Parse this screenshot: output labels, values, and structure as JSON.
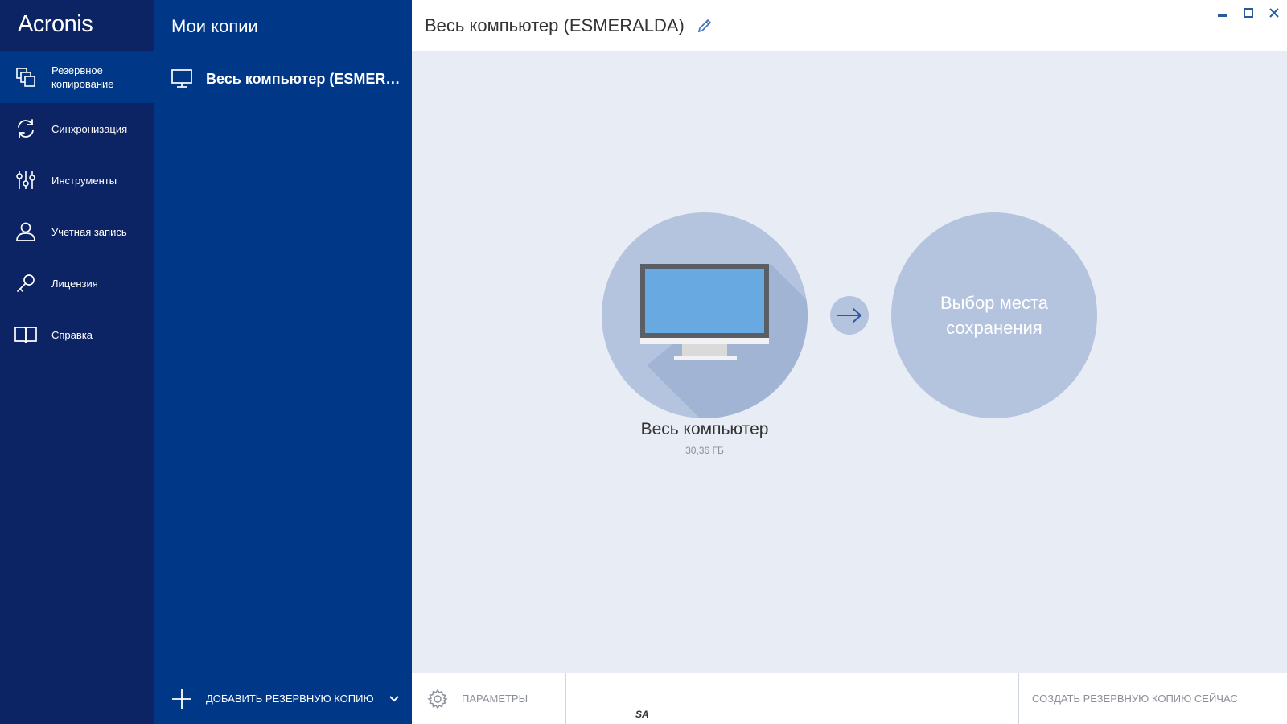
{
  "app": {
    "brand": "Acronis"
  },
  "nav": {
    "items": [
      {
        "label": "Резервное\nкопирование",
        "icon": "backup-icon",
        "active": true
      },
      {
        "label": "Синхронизация",
        "icon": "sync-icon"
      },
      {
        "label": "Инструменты",
        "icon": "tools-icon"
      },
      {
        "label": "Учетная запись",
        "icon": "account-icon"
      },
      {
        "label": "Лицензия",
        "icon": "license-key-icon"
      },
      {
        "label": "Справка",
        "icon": "help-book-icon"
      }
    ]
  },
  "list": {
    "title": "Мои копии",
    "items": [
      {
        "label": "Весь компьютер (ESMERALDA)",
        "icon": "monitor-icon"
      }
    ],
    "add_label": "ДОБАВИТЬ РЕЗЕРВНУЮ КОПИЮ"
  },
  "main": {
    "title": "Весь компьютер (ESMERALDA)",
    "source": {
      "title": "Весь компьютер",
      "size": "30,36 ГБ"
    },
    "destination": {
      "label": "Выбор места сохранения"
    },
    "footer": {
      "params_label": "ПАРАМЕТРЫ",
      "mark": "SA",
      "create_label": "СОЗДАТЬ РЕЗЕРВНУЮ КОПИЮ СЕЙЧАС"
    }
  },
  "colors": {
    "nav_bg": "#0c2463",
    "list_bg": "#003786",
    "main_bg": "#e8ecf4",
    "circle": "#b5c4de",
    "screen": "#67a9e0"
  }
}
